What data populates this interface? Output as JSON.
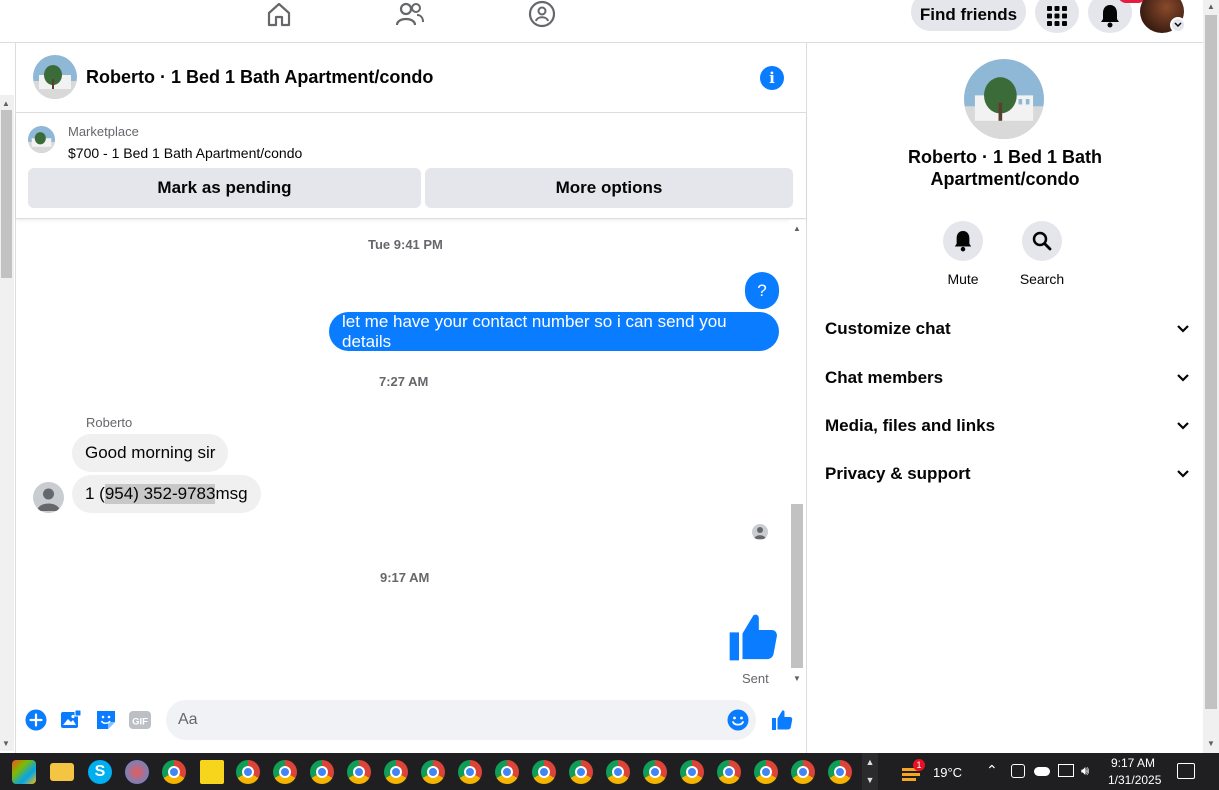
{
  "topbar": {
    "find_friends": "Find friends"
  },
  "chat": {
    "title": "Roberto · 1 Bed 1 Bath Apartment/condo",
    "marketplace": {
      "label": "Marketplace",
      "listing": "$700 - 1 Bed 1 Bath Apartment/condo",
      "mark_pending": "Mark as pending",
      "more_options": "More options"
    },
    "messages": {
      "ts1": "Tue 9:41 PM",
      "out1": "?",
      "out2": "let me have your contact number so i can send you details",
      "ts2": "7:27 AM",
      "sender": "Roberto",
      "in1": "Good morning sir",
      "in2_prefix": "1 (",
      "in2_highlight": "954) 352-9783",
      "in2_suffix": " msg",
      "ts3": "9:17 AM",
      "sent": "Sent"
    },
    "composer": {
      "placeholder": "Aa"
    }
  },
  "details": {
    "title": "Roberto · 1 Bed 1 Bath Apartment/condo",
    "mute": "Mute",
    "search": "Search",
    "sections": [
      "Customize chat",
      "Chat members",
      "Media, files and links",
      "Privacy & support"
    ]
  },
  "taskbar": {
    "weather": "19°C",
    "weather_badge": "1",
    "time": "9:17 AM",
    "date": "1/31/2025"
  },
  "colors": {
    "accent": "#0a7cff",
    "bubble_in": "#f0f0f0",
    "button_bg": "#e4e6eb"
  }
}
